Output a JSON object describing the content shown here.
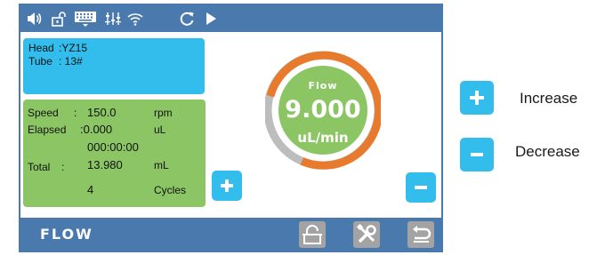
{
  "status_bar": {
    "icons": [
      "speaker-icon",
      "unlock-icon",
      "keyboard-icon",
      "sliders-icon",
      "wifi-icon",
      "refresh-icon",
      "play-icon"
    ]
  },
  "head_panel": {
    "head_label": "Head",
    "head_value": ":YZ15",
    "tube_label": "Tube",
    "tube_value": ": 13#"
  },
  "run_panel": {
    "speed_label": "Speed",
    "speed_sep": ":",
    "speed_value": "150.0",
    "speed_unit": "rpm",
    "elapsed_label": "Elapsed",
    "elapsed_value": ":0.000",
    "elapsed_unit": "uL",
    "elapsed_time": "000:00:00",
    "total_label": "Total",
    "total_sep": ":",
    "total_value": "13.980",
    "total_unit": "mL",
    "cycles_value": "4",
    "cycles_label": "Cycles"
  },
  "gauge": {
    "title": "Flow",
    "value": "9.000",
    "unit": "uL/min",
    "colors": {
      "active_arc": "#e87a2d",
      "track_arc": "#bdbdbd",
      "inner": "#8cc664"
    }
  },
  "bottom_bar": {
    "mode": "FLOW",
    "buttons": [
      "unlock-icon",
      "tools-icon",
      "back-icon"
    ]
  },
  "legend": {
    "increase": "Increase",
    "decrease": "Decrease"
  },
  "colors": {
    "bar": "#4a79ad",
    "accent_blue": "#33bdec",
    "accent_green": "#8cc664",
    "disabled": "#a3a3a3"
  }
}
